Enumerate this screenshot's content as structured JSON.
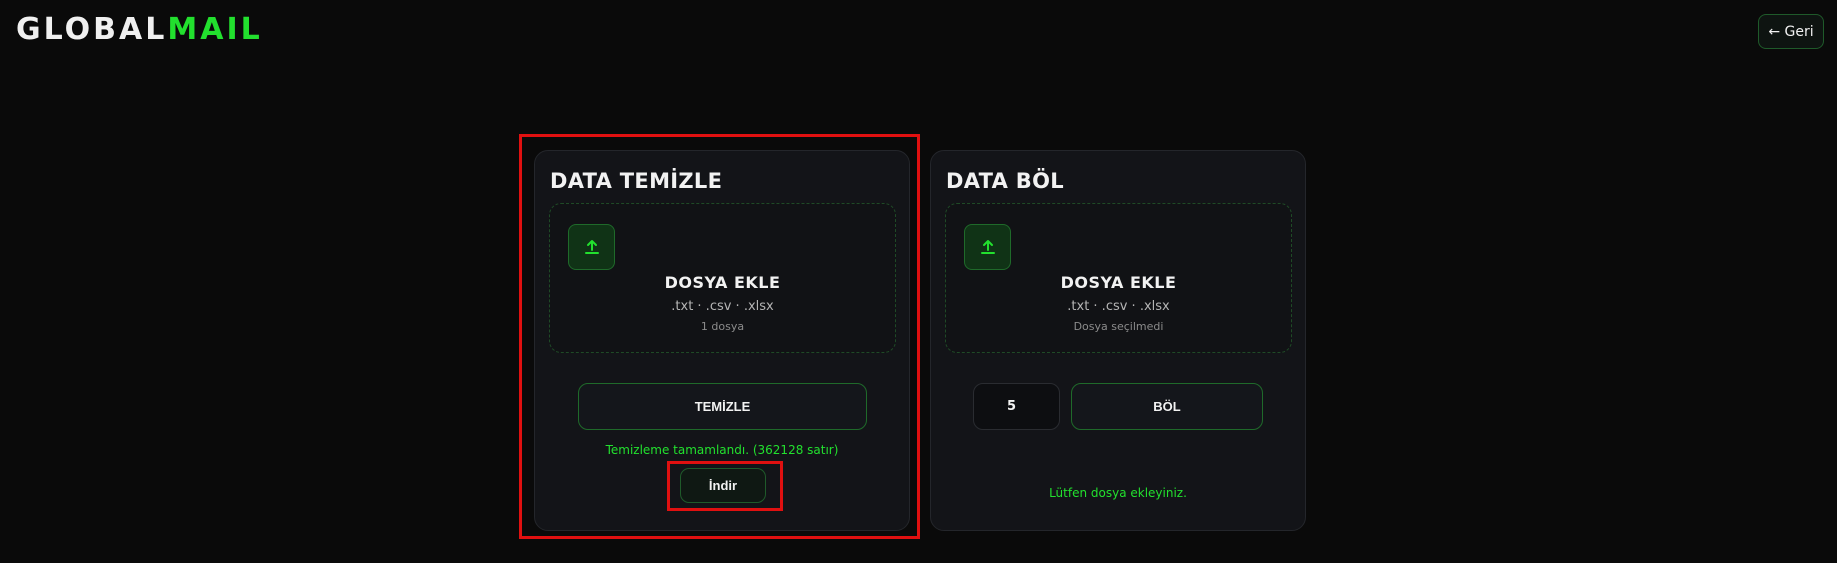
{
  "header": {
    "logo_part1": "GLOBAL",
    "logo_part2": "MAIL",
    "back_label": "← Geri"
  },
  "clean_card": {
    "title": "DATA TEMİZLE",
    "dropzone": {
      "icon": "upload-icon",
      "title": "DOSYA EKLE",
      "types": ".txt · .csv · .xlsx",
      "status": "1 dosya"
    },
    "action_label": "TEMİZLE",
    "result_message": "Temizleme tamamlandı. (362128 satır)",
    "download_label": "İndir"
  },
  "split_card": {
    "title": "DATA BÖL",
    "dropzone": {
      "icon": "upload-icon",
      "title": "DOSYA EKLE",
      "types": ".txt · .csv · .xlsx",
      "status": "Dosya seçilmedi"
    },
    "parts_value": "5",
    "action_label": "BÖL",
    "message": "Lütfen dosya ekleyiniz."
  },
  "colors": {
    "accent": "#22e02e",
    "background": "#0a0a0a",
    "card": "#131418",
    "highlight": "#e01010"
  }
}
